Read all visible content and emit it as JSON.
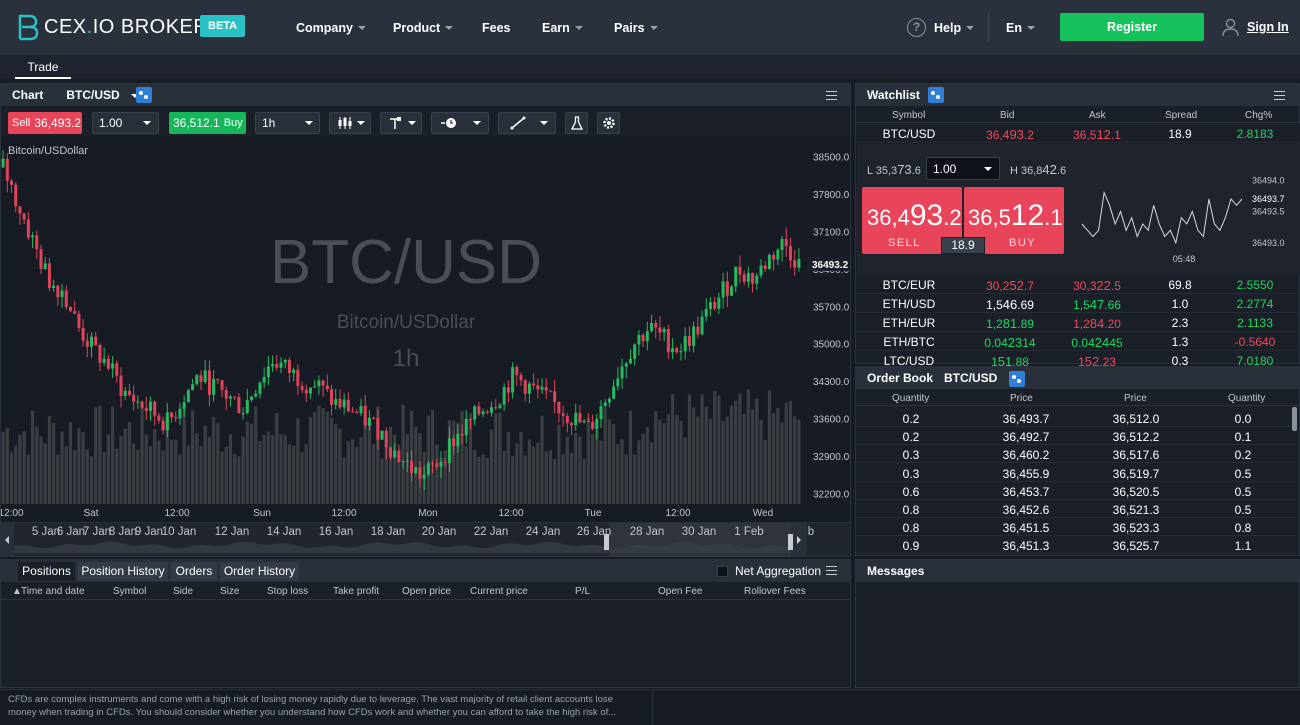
{
  "brand": {
    "name_left": "CEX",
    "name_dot": ".",
    "name_mid": "IO",
    "name_right": " BROKER",
    "badge": "BETA"
  },
  "nav": {
    "items": [
      {
        "label": "Company",
        "dropdown": true
      },
      {
        "label": "Product",
        "dropdown": true
      },
      {
        "label": "Fees",
        "dropdown": false
      },
      {
        "label": "Earn",
        "dropdown": true
      },
      {
        "label": "Pairs",
        "dropdown": true
      }
    ],
    "help": "Help",
    "help_icon": "?",
    "lang": "En",
    "register": "Register",
    "signin": "Sign In"
  },
  "tabs": {
    "trade": "Trade"
  },
  "chart": {
    "title": "Chart",
    "pair": "BTC/USD",
    "sell_label": "Sell",
    "sell_price": "36,493.2",
    "qty": "1.00",
    "buy_price": "36,512.1",
    "buy_label": "Buy",
    "interval": "1h",
    "legend": "Bitcoin/USDollar",
    "watermark_pair": "BTC/USD",
    "watermark_name": "Bitcoin/USDollar",
    "watermark_interval": "1h",
    "last_price_tag": "36493.2",
    "nav_labels": [
      "5 Jan",
      "6 Jan",
      "7 Jan",
      "8 Jan",
      "9 Jan",
      "10 Jan",
      "12 Jan",
      "14 Jan",
      "16 Jan",
      "18 Jan",
      "20 Jan",
      "22 Jan",
      "24 Jan",
      "26 Jan",
      "28 Jan",
      "30 Jan",
      "1 Feb",
      "b"
    ]
  },
  "chart_data": {
    "type": "candlestick",
    "y_ticks": [
      38500,
      37800,
      37100,
      36400,
      35700,
      35000,
      34300,
      33600,
      32900,
      32200
    ],
    "ylim": [
      32000,
      38700
    ],
    "x_ticks": [
      "12:00",
      "Sat",
      "12:00",
      "Sun",
      "12:00",
      "Mon",
      "12:00",
      "Tue",
      "12:00",
      "Wed"
    ],
    "last_price": 36493.2,
    "series": [
      {
        "name": "BTC/USD",
        "close_approx": [
          38300,
          37600,
          36900,
          36200,
          36000,
          35300,
          34900,
          34600,
          34100,
          33900,
          33700,
          33500,
          34000,
          34400,
          34200,
          34000,
          33800,
          34300,
          34700,
          34500,
          34300,
          34200,
          33900,
          33800,
          33600,
          33400,
          33000,
          32700,
          32500,
          32800,
          33200,
          33500,
          33800,
          34000,
          34400,
          34200,
          34000,
          33800,
          33600,
          33400,
          33900,
          34500,
          35000,
          35300,
          35100,
          34900,
          35200,
          35600,
          36000,
          36400,
          36200,
          36600,
          36900,
          36493.2
        ]
      }
    ]
  },
  "positions": {
    "tabs": [
      "Positions",
      "Position History",
      "Orders",
      "Order History"
    ],
    "net_aggregation": "Net Aggregation",
    "columns": [
      "Time and date",
      "Symbol",
      "Side",
      "Size",
      "Stop loss",
      "Take profit",
      "Open price",
      "Current price",
      "P/L",
      "Open Fee",
      "Rollover Fees"
    ]
  },
  "watchlist": {
    "title": "Watchlist",
    "columns": [
      "Symbol",
      "Bid",
      "Ask",
      "Spread",
      "Chg%"
    ],
    "rows": [
      {
        "symbol": "BTC/USD",
        "bid_a": "36,4",
        "bid_b": "93",
        "bid_c": ".2",
        "ask_a": "36,5",
        "ask_b": "12",
        ".": "",
        "ask_c": ".1",
        "spread": "18.9",
        "chg": "2.8183",
        "bid_color": "red",
        "ask_color": "red",
        "chg_color": "green"
      },
      {
        "symbol": "BTC/EUR",
        "bid_a": "30,2",
        "bid_b": "52",
        ".": "",
        "bid_c": ".7",
        "ask_a": "30,3",
        "ask_b": "22",
        "ask_c": ".5",
        "spread": "69.8",
        "chg": "2.5550",
        "bid_color": "red",
        "ask_color": "red",
        "chg_color": "green"
      },
      {
        "symbol": "ETH/USD",
        "bid_a": "1,5",
        "bid_b": "46",
        "bid_c": ".69",
        "ask_a": "1,5",
        "ask_b": "47",
        "ask_c": ".66",
        "spread": "1.0",
        "chg": "2.2774",
        "bid_color": "white",
        "ask_color": "green",
        "chg_color": "green"
      },
      {
        "symbol": "ETH/EUR",
        "bid_a": "1,2",
        "bid_b": "81",
        "bid_c": ".89",
        "ask_a": "1,2",
        "ask_b": "84",
        "ask_c": ".20",
        "spread": "2.3",
        "chg": "2.1133",
        "bid_color": "green",
        "ask_color": "red",
        "chg_color": "green"
      },
      {
        "symbol": "ETH/BTC",
        "bid_a": "0.04",
        "bid_b": "23",
        "bid_c": "14",
        "ask_a": "0.04",
        "ask_b": "24",
        "ask_c": "45",
        "spread": "1.3",
        "chg": "-0.5640",
        "bid_color": "green",
        "ask_color": "green",
        "chg_color": "red"
      },
      {
        "symbol": "LTC/USD",
        "bid_a": "1",
        "bid_b": "51",
        "bid_c": ".88",
        "ask_a": "1",
        "ask_b": "52",
        "ask_c": ".23",
        "spread": "0.3",
        "chg": "7.0180",
        "bid_color": "green",
        "ask_color": "red",
        "chg_color": "green"
      }
    ],
    "detail": {
      "low_label": "L 35,3",
      "low_big": "73",
      "low_small": ".6",
      "qty": "1.00",
      "high_label": "H 36,8",
      "high_big": "42",
      "high_small": ".6",
      "sell_a": "36,4",
      "sell_big": "93",
      "sell_small": ".2",
      "sell_label": "SELL",
      "buy_a": "36,5",
      "buy_big": "12",
      "buy_small": ".1",
      "buy_label": "BUY",
      "spread": "18.9",
      "mini_ticks": [
        "36494.0",
        "36493.7",
        "36493.5",
        "36493.0"
      ],
      "mini_time": "05:48",
      "mini_values": [
        36493.3,
        36493.2,
        36493.1,
        36493.2,
        36493.8,
        36493.6,
        36493.3,
        36493.5,
        36493.2,
        36493.4,
        36493.1,
        36493.3,
        36493.2,
        36493.6,
        36493.3,
        36493.1,
        36493.2,
        36493.0,
        36493.4,
        36493.3,
        36493.5,
        36493.2,
        36493.1,
        36493.7,
        36493.3,
        36493.2,
        36493.4,
        36493.7,
        36493.6,
        36493.7
      ]
    }
  },
  "orderbook": {
    "title": "Order Book",
    "pair": "BTC/USD",
    "columns": [
      "Quantity",
      "Price",
      "Price",
      "Quantity"
    ],
    "rows": [
      [
        "0.2",
        "36,493.7",
        "36,512.0",
        "0.0"
      ],
      [
        "0.2",
        "36,492.7",
        "36,512.2",
        "0.1"
      ],
      [
        "0.3",
        "36,460.2",
        "36,517.6",
        "0.2"
      ],
      [
        "0.3",
        "36,455.9",
        "36,519.7",
        "0.5"
      ],
      [
        "0.6",
        "36,453.7",
        "36,520.5",
        "0.5"
      ],
      [
        "0.8",
        "36,452.6",
        "36,521.3",
        "0.5"
      ],
      [
        "0.8",
        "36,451.5",
        "36,523.3",
        "0.8"
      ],
      [
        "0.9",
        "36,451.3",
        "36,525.7",
        "1.1"
      ]
    ]
  },
  "messages": {
    "title": "Messages"
  },
  "disclaimer": "CFDs are complex instruments and come with a high risk of losing money rapidly due to leverage. The vast majority of retail client accounts lose money when trading in CFDs. You should consider whether you understand how CFDs work and whether you can afford to take the high risk of...",
  "colors": {
    "red": "#f0485d",
    "green": "#1ed760",
    "accent": "#29c2c7",
    "register": "#16c25b",
    "blue": "#2f7fd6"
  }
}
